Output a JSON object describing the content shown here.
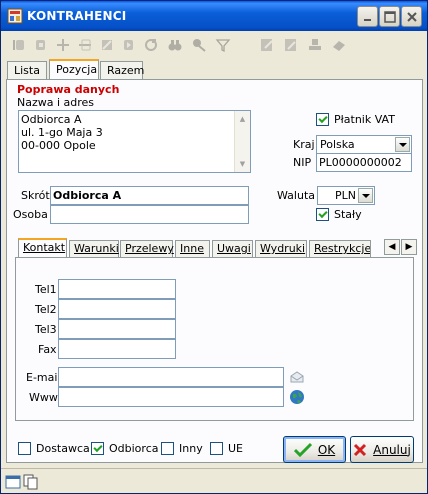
{
  "window": {
    "title": "KONTRAHENCI"
  },
  "main_tabs": [
    {
      "label": "Lista"
    },
    {
      "label": "Pozycja"
    },
    {
      "label": "Razem"
    }
  ],
  "section": {
    "title": "Poprawa danych"
  },
  "address": {
    "label": "Nazwa i adres",
    "lines": [
      "Odbiorca A",
      "ul. 1-go Maja 3",
      "00-000 Opole"
    ]
  },
  "vat": {
    "label": "Płatnik VAT",
    "checked": true
  },
  "country": {
    "label": "Kraj",
    "value": "Polska"
  },
  "nip": {
    "label": "NIP",
    "value": "PL0000000002"
  },
  "short": {
    "label": "Skrót",
    "value": "Odbiorca A"
  },
  "person": {
    "label": "Osoba",
    "value": ""
  },
  "currency": {
    "label": "Waluta",
    "value": "PLN"
  },
  "fixed": {
    "label": "Stały",
    "checked": true
  },
  "sub_tabs": [
    {
      "label": "Kontakt"
    },
    {
      "label": "Warunki"
    },
    {
      "label": "Przelewy"
    },
    {
      "label": "Inne"
    },
    {
      "label": "Uwagi"
    },
    {
      "label": "Wydruki"
    },
    {
      "label": "Restrykcje"
    }
  ],
  "contact": {
    "tel1": "Tel1",
    "tel2": "Tel2",
    "tel3": "Tel3",
    "fax": "Fax",
    "email": "E-mail",
    "www": "Www"
  },
  "roles": {
    "supplier": "Dostawca",
    "customer": "Odbiorca",
    "other": "Inny",
    "eu": "UE"
  },
  "buttons": {
    "ok": "OK",
    "cancel": "Anuluj"
  },
  "colors": {
    "title_bar": "#0a5fd8",
    "section_title": "#cc0000",
    "tab_highlight": "#f4a623"
  }
}
